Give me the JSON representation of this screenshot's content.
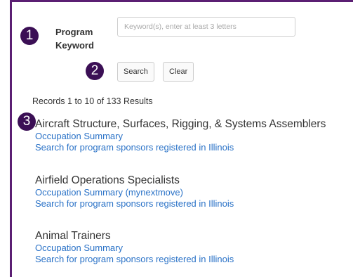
{
  "markers": [
    "1",
    "2",
    "3"
  ],
  "search": {
    "label": "Program Keyword",
    "placeholder": "Keyword(s), enter at least 3 letters",
    "value": ""
  },
  "buttons": {
    "search": "Search",
    "clear": "Clear"
  },
  "records_text": "Records 1 to 10 of 133 Results",
  "results": [
    {
      "title": "Aircraft Structure, Surfaces, Rigging, & Systems Assemblers",
      "link1": "Occupation Summary",
      "link2": "Search for program sponsors registered in Illinois"
    },
    {
      "title": "Airfield Operations Specialists",
      "link1": "Occupation Summary (mynextmove)",
      "link2": "Search for program sponsors registered in Illinois"
    },
    {
      "title": "Animal Trainers",
      "link1": "Occupation Summary",
      "link2": "Search for program sponsors registered in Illinois"
    }
  ],
  "colors": {
    "frame": "#5b1f73",
    "marker": "#3b0f55",
    "link": "#2a72c7"
  }
}
